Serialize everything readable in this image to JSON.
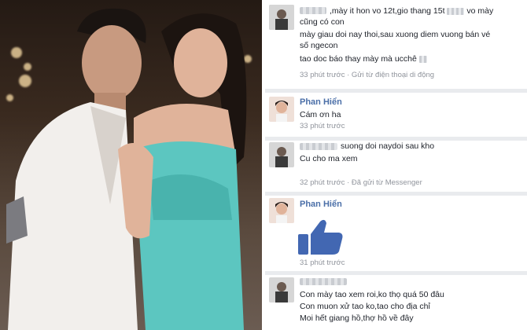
{
  "comments": [
    {
      "author": "",
      "line1_rest": ",mày it hon vo 12t,gio thang 15t",
      "line1_tail": "vo mày",
      "line2": "cũng có con",
      "line3": "mày giau doi nay thoi,sau xuong diem vuong bán vé",
      "line4": "số ngecon",
      "line5": "tao doc báo thay mày mà ucchê",
      "meta": "33 phút trước · Gửi từ điện thoại di động"
    },
    {
      "author": "Phan Hiển",
      "line1": "Cám ơn ha",
      "meta": "33 phút trước"
    },
    {
      "author": "",
      "line1": "suong doi naydoi sau kho",
      "line2": "Cu cho ma xem",
      "meta": "32 phút trước · Đã gửi từ Messenger"
    },
    {
      "author": "Phan Hiển",
      "sticker": "thumbs-up",
      "meta": "31 phút trước"
    },
    {
      "author": "",
      "line1": "Con mày tao xem roi,ko thọ quá 50 đâu",
      "line2": "Con muon xử tao ko,tao cho địa chỉ",
      "line3": "Moi hết giang hồ,thợ hồ về đây"
    }
  ],
  "colors": {
    "name_blue": "#4b6fa8",
    "like_blue": "#4267b2",
    "meta_gray": "#90949c",
    "separator": "#e9ebee"
  }
}
